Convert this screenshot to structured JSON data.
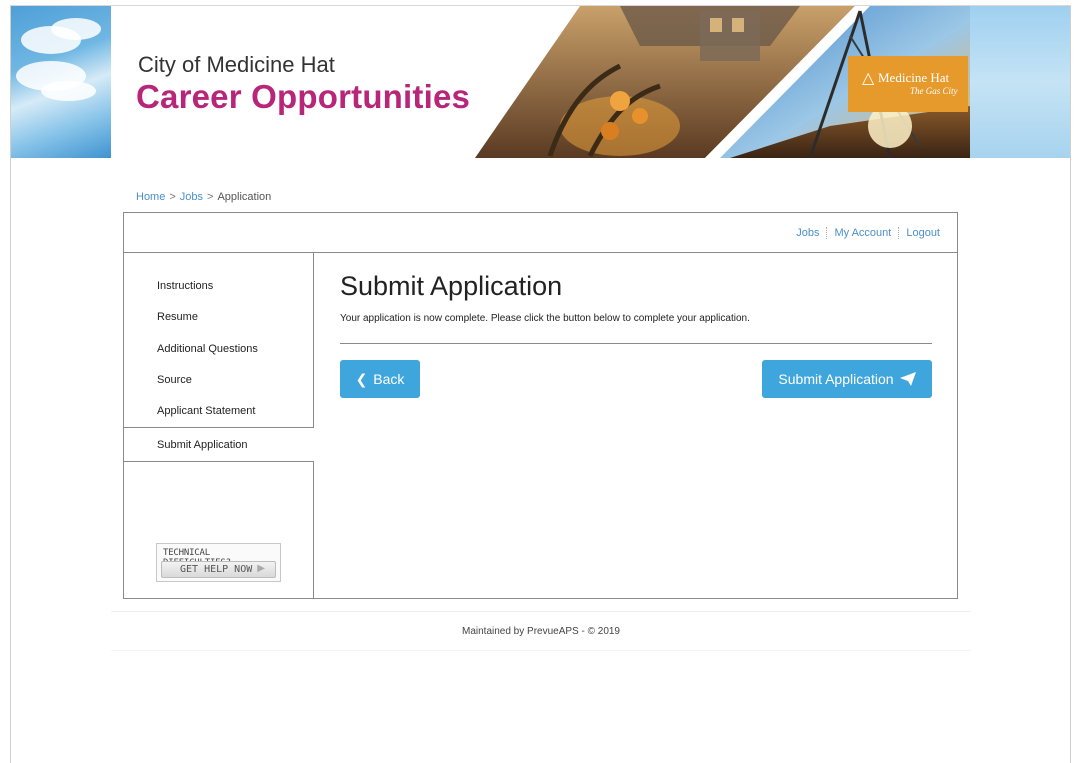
{
  "header": {
    "city_name": "City of Medicine Hat",
    "site_title": "Career Opportunities",
    "logo_name": "Medicine Hat",
    "logo_tagline": "The Gas City"
  },
  "breadcrumb": {
    "items": [
      "Home",
      "Jobs",
      "Application"
    ],
    "separator": ">"
  },
  "topnav": {
    "items": [
      "Jobs",
      "My Account",
      "Logout"
    ]
  },
  "sidebar": {
    "items": [
      "Instructions",
      "Resume",
      "Additional Questions",
      "Source",
      "Applicant Statement"
    ],
    "active_item": "Submit Application",
    "help_line1": "TECHNICAL DIFFICULTIES?",
    "help_line2": "GET HELP NOW"
  },
  "main": {
    "title": "Submit Application",
    "message": "Your application is now complete. Please click the button below to complete your application.",
    "back_label": "Back",
    "submit_label": "Submit Application"
  },
  "footer": {
    "text": "Maintained by PrevueAPS - © 2019"
  },
  "colors": {
    "brand_magenta": "#b8267a",
    "button_blue": "#3fa6dd",
    "link_blue": "#4a90c9",
    "logo_orange": "#e69a2c"
  },
  "icons": {
    "back": "chevron-left-icon",
    "submit": "paper-plane-icon",
    "help_arrow": "arrow-right-icon",
    "logo": "tipi-icon"
  }
}
